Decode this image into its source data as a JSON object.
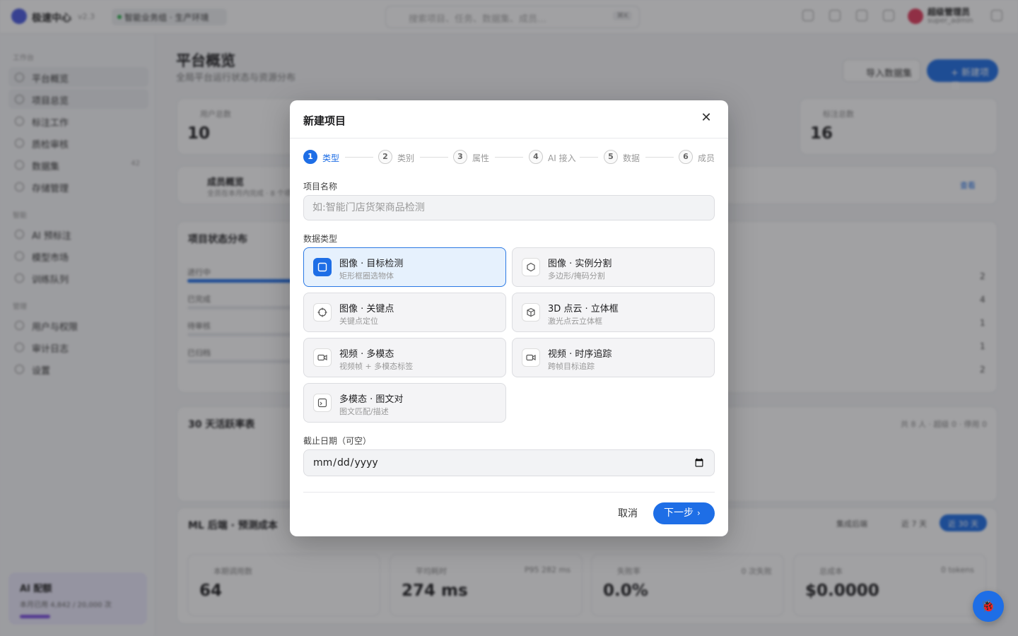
{
  "app": {
    "brand": "极速中心",
    "version": "v2.3",
    "workspace": "智能业务组 · 生产环境",
    "search_placeholder": "搜索项目、任务、数据集、成员…",
    "search_shortcut": "⌘K",
    "user_name": "超级管理员",
    "user_role": "super_admin"
  },
  "sidebar": {
    "sections": [
      "工作台",
      "智能",
      "管理"
    ],
    "items": [
      {
        "label": "平台概览"
      },
      {
        "label": "项目总览"
      },
      {
        "label": "标注工作"
      },
      {
        "label": "质检审核"
      },
      {
        "label": "数据集",
        "badge": "42"
      },
      {
        "label": "存储管理"
      },
      {
        "label": "AI 预标注"
      },
      {
        "label": "模型市场"
      },
      {
        "label": "训练队列"
      },
      {
        "label": "用户与权限"
      },
      {
        "label": "审计日志"
      },
      {
        "label": "设置"
      }
    ],
    "ai_quota": {
      "title": "AI 配额",
      "usage": "本月已用 4,842 / 20,000 次",
      "fraction": 0.24
    }
  },
  "main": {
    "title": "平台概览",
    "subtitle": "全局平台运行状态与资源分布",
    "import_button": "导入数据集",
    "new_button": "+ 新建项目",
    "stats": [
      {
        "label": "用户总数",
        "value": "10"
      },
      {
        "label": "标注总数",
        "value": "16"
      }
    ],
    "banner": {
      "title": "成员概览",
      "sub": "全员在本月内完成 · 8 个项目",
      "link": "查看"
    },
    "status_title": "项目状态分布",
    "status_rows": [
      {
        "label": "进行中",
        "value": "2"
      },
      {
        "label": "已完成",
        "value": "4"
      },
      {
        "label": "待审核",
        "value": "1"
      },
      {
        "label": "已归档",
        "value": "1"
      },
      {
        "label": "",
        "value": "2"
      }
    ],
    "focus_title": "30 天活跃率表",
    "focus_meta": "共 8 人 · 超级 0 · 停用 0",
    "ml_title": "ML 后端 · 预测成本",
    "ml_controls": [
      "集成后端",
      "近 7 天",
      "近 30 天"
    ],
    "ml_stats": [
      {
        "label": "本期调用数",
        "value": "64"
      },
      {
        "label": "平均耗时",
        "value": "274 ms",
        "extra": "P95 282 ms"
      },
      {
        "label": "失败率",
        "value": "0.0%",
        "extra": "0 次失败"
      },
      {
        "label": "总成本",
        "value": "$0.0000",
        "extra": "0 tokens"
      }
    ]
  },
  "modal": {
    "title": "新建项目",
    "steps": [
      {
        "num": "1",
        "label": "类型"
      },
      {
        "num": "2",
        "label": "类别"
      },
      {
        "num": "3",
        "label": "属性"
      },
      {
        "num": "4",
        "label": "AI 接入"
      },
      {
        "num": "5",
        "label": "数据"
      },
      {
        "num": "6",
        "label": "成员"
      }
    ],
    "active_step": 1,
    "name_label": "项目名称",
    "name_placeholder": "如:智能门店货架商品检测",
    "type_label": "数据类型",
    "types": [
      {
        "title": "图像 · 目标检测",
        "sub": "矩形框圈选物体",
        "icon": "square-icon",
        "selected": true
      },
      {
        "title": "图像 · 实例分割",
        "sub": "多边形/掩码分割",
        "icon": "hexagon-icon",
        "selected": false
      },
      {
        "title": "图像 · 关键点",
        "sub": "关键点定位",
        "icon": "crosshair-icon",
        "selected": false
      },
      {
        "title": "3D 点云 · 立体框",
        "sub": "激光点云立体框",
        "icon": "cube-icon",
        "selected": false
      },
      {
        "title": "视频 · 多模态",
        "sub": "视频帧 + 多模态标签",
        "icon": "video-icon",
        "selected": false
      },
      {
        "title": "视频 · 时序追踪",
        "sub": "跨帧目标追踪",
        "icon": "video-icon",
        "selected": false
      },
      {
        "title": "多模态 · 图文对",
        "sub": "图文匹配/描述",
        "icon": "image-icon",
        "selected": false
      }
    ],
    "deadline_label": "截止日期（可空）",
    "cancel_label": "取消",
    "next_label": "下一步"
  },
  "fab_label": "🐞",
  "colors": {
    "accent": "#1e6ee6",
    "overlay": "rgba(30,32,36,0.42)"
  }
}
